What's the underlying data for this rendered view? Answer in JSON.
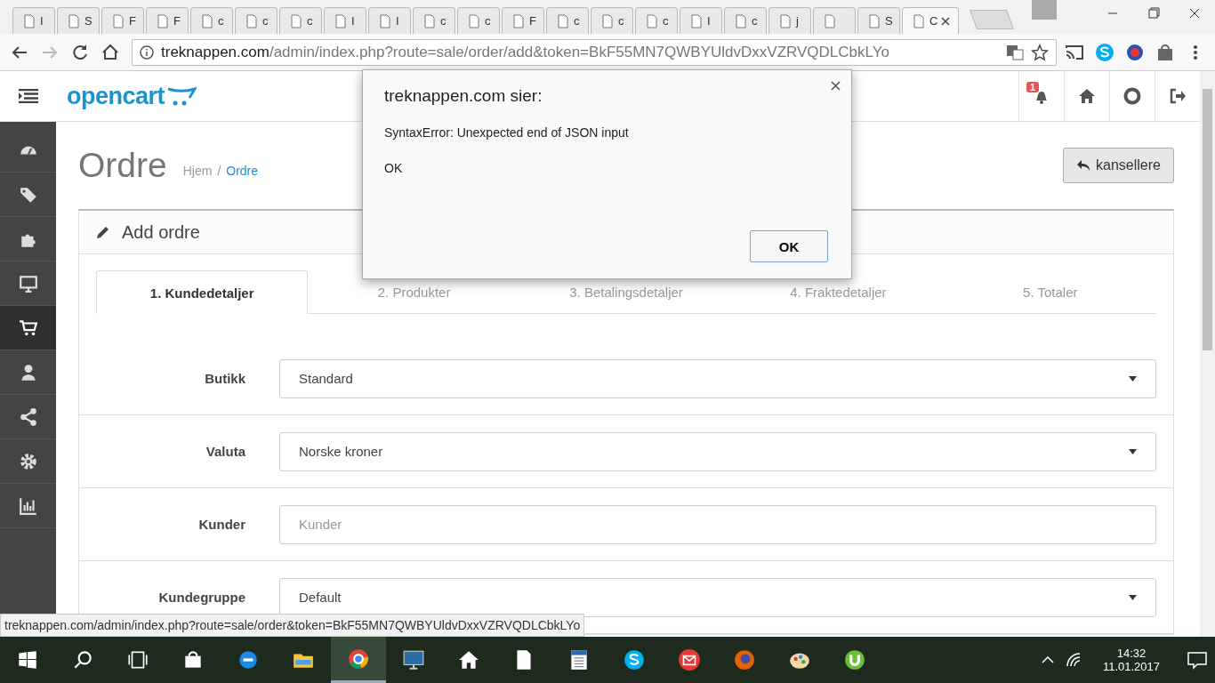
{
  "browser": {
    "tabs": [
      {
        "title": "I",
        "selected": false
      },
      {
        "title": "S",
        "selected": false
      },
      {
        "title": "F",
        "selected": false
      },
      {
        "title": "F",
        "selected": false
      },
      {
        "title": "c",
        "selected": false
      },
      {
        "title": "c",
        "selected": false
      },
      {
        "title": "c",
        "selected": false
      },
      {
        "title": "I",
        "selected": false
      },
      {
        "title": "I",
        "selected": false
      },
      {
        "title": "c",
        "selected": false
      },
      {
        "title": "c",
        "selected": false
      },
      {
        "title": "F",
        "selected": false
      },
      {
        "title": "c",
        "selected": false
      },
      {
        "title": "c",
        "selected": false
      },
      {
        "title": "c",
        "selected": false
      },
      {
        "title": "I",
        "selected": false
      },
      {
        "title": "c",
        "selected": false
      },
      {
        "title": "j",
        "selected": false
      },
      {
        "selected": false
      },
      {
        "title": "S",
        "selected": false
      },
      {
        "title": "C",
        "selected": true
      }
    ],
    "url_host": "treknappen.com",
    "url_path": "/admin/index.php?route=sale/order/add&token=BkF55MN7QWBYUldvDxxVZRVQDLCbkLYo",
    "status_url": "treknappen.com/admin/index.php?route=sale/order&token=BkF55MN7QWBYUldvDxxVZRVQDLCbkLYo"
  },
  "header": {
    "logo": "opencart",
    "notification_count": "1"
  },
  "sidebar": {
    "items": [
      {
        "selected": false
      },
      {
        "selected": false
      },
      {
        "selected": false
      },
      {
        "selected": false
      },
      {
        "selected": true
      },
      {
        "selected": false
      },
      {
        "selected": false
      },
      {
        "selected": false
      },
      {
        "selected": false
      }
    ]
  },
  "page": {
    "title": "Ordre",
    "breadcrumb": [
      {
        "label": "Hjem"
      },
      {
        "label": "Ordre"
      }
    ],
    "breadcrumb_separator": "/",
    "cancel_button": "kansellere"
  },
  "panel": {
    "title": "Add ordre",
    "tabs": [
      {
        "label": "1. Kundedetaljer",
        "selected": true
      },
      {
        "label": "2. Produkter",
        "selected": false
      },
      {
        "label": "3. Betalingsdetaljer",
        "selected": false
      },
      {
        "label": "4. Fraktedetaljer",
        "selected": false
      },
      {
        "label": "5. Totaler",
        "selected": false
      }
    ],
    "fields": [
      {
        "label": "Butikk",
        "kind": "select",
        "value": "Standard"
      },
      {
        "label": "Valuta",
        "kind": "select",
        "value": "Norske kroner"
      },
      {
        "label": "Kunder",
        "kind": "input",
        "placeholder": "Kunder"
      },
      {
        "label": "Kundegruppe",
        "kind": "select",
        "value": "Default"
      }
    ]
  },
  "dialog": {
    "title": "treknappen.com sier:",
    "message": "SyntaxError: Unexpected end of JSON input",
    "detail": "OK",
    "button": "OK"
  },
  "taskbar": {
    "apps": [
      {
        "active": false
      },
      {
        "active": false
      },
      {
        "active": false
      },
      {
        "active": true
      },
      {
        "active": false
      },
      {
        "active": false
      },
      {
        "active": false
      },
      {
        "active": false
      },
      {
        "active": false
      },
      {
        "active": false
      },
      {
        "active": false
      },
      {
        "active": false
      },
      {
        "active": false
      }
    ],
    "time": "14:32",
    "date": "11.01.2017"
  }
}
